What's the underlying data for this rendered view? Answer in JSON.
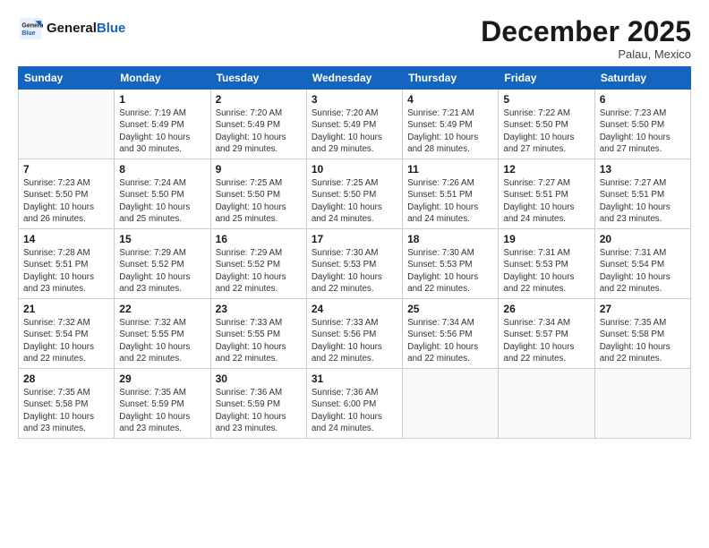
{
  "header": {
    "logo_line1": "General",
    "logo_line2": "Blue",
    "month": "December 2025",
    "location": "Palau, Mexico"
  },
  "weekdays": [
    "Sunday",
    "Monday",
    "Tuesday",
    "Wednesday",
    "Thursday",
    "Friday",
    "Saturday"
  ],
  "weeks": [
    [
      {
        "day": "",
        "info": ""
      },
      {
        "day": "1",
        "info": "Sunrise: 7:19 AM\nSunset: 5:49 PM\nDaylight: 10 hours\nand 30 minutes."
      },
      {
        "day": "2",
        "info": "Sunrise: 7:20 AM\nSunset: 5:49 PM\nDaylight: 10 hours\nand 29 minutes."
      },
      {
        "day": "3",
        "info": "Sunrise: 7:20 AM\nSunset: 5:49 PM\nDaylight: 10 hours\nand 29 minutes."
      },
      {
        "day": "4",
        "info": "Sunrise: 7:21 AM\nSunset: 5:49 PM\nDaylight: 10 hours\nand 28 minutes."
      },
      {
        "day": "5",
        "info": "Sunrise: 7:22 AM\nSunset: 5:50 PM\nDaylight: 10 hours\nand 27 minutes."
      },
      {
        "day": "6",
        "info": "Sunrise: 7:23 AM\nSunset: 5:50 PM\nDaylight: 10 hours\nand 27 minutes."
      }
    ],
    [
      {
        "day": "7",
        "info": "Sunrise: 7:23 AM\nSunset: 5:50 PM\nDaylight: 10 hours\nand 26 minutes."
      },
      {
        "day": "8",
        "info": "Sunrise: 7:24 AM\nSunset: 5:50 PM\nDaylight: 10 hours\nand 25 minutes."
      },
      {
        "day": "9",
        "info": "Sunrise: 7:25 AM\nSunset: 5:50 PM\nDaylight: 10 hours\nand 25 minutes."
      },
      {
        "day": "10",
        "info": "Sunrise: 7:25 AM\nSunset: 5:50 PM\nDaylight: 10 hours\nand 24 minutes."
      },
      {
        "day": "11",
        "info": "Sunrise: 7:26 AM\nSunset: 5:51 PM\nDaylight: 10 hours\nand 24 minutes."
      },
      {
        "day": "12",
        "info": "Sunrise: 7:27 AM\nSunset: 5:51 PM\nDaylight: 10 hours\nand 24 minutes."
      },
      {
        "day": "13",
        "info": "Sunrise: 7:27 AM\nSunset: 5:51 PM\nDaylight: 10 hours\nand 23 minutes."
      }
    ],
    [
      {
        "day": "14",
        "info": "Sunrise: 7:28 AM\nSunset: 5:51 PM\nDaylight: 10 hours\nand 23 minutes."
      },
      {
        "day": "15",
        "info": "Sunrise: 7:29 AM\nSunset: 5:52 PM\nDaylight: 10 hours\nand 23 minutes."
      },
      {
        "day": "16",
        "info": "Sunrise: 7:29 AM\nSunset: 5:52 PM\nDaylight: 10 hours\nand 22 minutes."
      },
      {
        "day": "17",
        "info": "Sunrise: 7:30 AM\nSunset: 5:53 PM\nDaylight: 10 hours\nand 22 minutes."
      },
      {
        "day": "18",
        "info": "Sunrise: 7:30 AM\nSunset: 5:53 PM\nDaylight: 10 hours\nand 22 minutes."
      },
      {
        "day": "19",
        "info": "Sunrise: 7:31 AM\nSunset: 5:53 PM\nDaylight: 10 hours\nand 22 minutes."
      },
      {
        "day": "20",
        "info": "Sunrise: 7:31 AM\nSunset: 5:54 PM\nDaylight: 10 hours\nand 22 minutes."
      }
    ],
    [
      {
        "day": "21",
        "info": "Sunrise: 7:32 AM\nSunset: 5:54 PM\nDaylight: 10 hours\nand 22 minutes."
      },
      {
        "day": "22",
        "info": "Sunrise: 7:32 AM\nSunset: 5:55 PM\nDaylight: 10 hours\nand 22 minutes."
      },
      {
        "day": "23",
        "info": "Sunrise: 7:33 AM\nSunset: 5:55 PM\nDaylight: 10 hours\nand 22 minutes."
      },
      {
        "day": "24",
        "info": "Sunrise: 7:33 AM\nSunset: 5:56 PM\nDaylight: 10 hours\nand 22 minutes."
      },
      {
        "day": "25",
        "info": "Sunrise: 7:34 AM\nSunset: 5:56 PM\nDaylight: 10 hours\nand 22 minutes."
      },
      {
        "day": "26",
        "info": "Sunrise: 7:34 AM\nSunset: 5:57 PM\nDaylight: 10 hours\nand 22 minutes."
      },
      {
        "day": "27",
        "info": "Sunrise: 7:35 AM\nSunset: 5:58 PM\nDaylight: 10 hours\nand 22 minutes."
      }
    ],
    [
      {
        "day": "28",
        "info": "Sunrise: 7:35 AM\nSunset: 5:58 PM\nDaylight: 10 hours\nand 23 minutes."
      },
      {
        "day": "29",
        "info": "Sunrise: 7:35 AM\nSunset: 5:59 PM\nDaylight: 10 hours\nand 23 minutes."
      },
      {
        "day": "30",
        "info": "Sunrise: 7:36 AM\nSunset: 5:59 PM\nDaylight: 10 hours\nand 23 minutes."
      },
      {
        "day": "31",
        "info": "Sunrise: 7:36 AM\nSunset: 6:00 PM\nDaylight: 10 hours\nand 24 minutes."
      },
      {
        "day": "",
        "info": ""
      },
      {
        "day": "",
        "info": ""
      },
      {
        "day": "",
        "info": ""
      }
    ]
  ]
}
